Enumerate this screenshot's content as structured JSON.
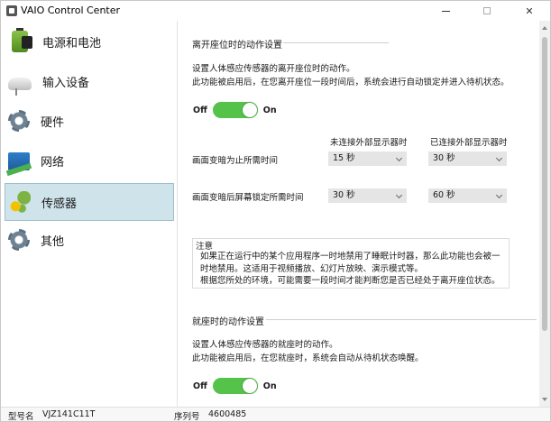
{
  "window": {
    "title": "VAIO Control Center"
  },
  "sidebar": {
    "items": [
      {
        "label": "电源和电池",
        "icon": "battery-icon"
      },
      {
        "label": "输入设备",
        "icon": "mouse-icon"
      },
      {
        "label": "硬件",
        "icon": "gear-icon"
      },
      {
        "label": "网络",
        "icon": "network-icon"
      },
      {
        "label": "传感器",
        "icon": "sensor-icon",
        "selected": true
      },
      {
        "label": "其他",
        "icon": "gear-icon"
      }
    ]
  },
  "away_section": {
    "title": "离开座位时的动作设置",
    "desc_line1": "设置人体感应传感器的离开座位时的动作。",
    "desc_line2": "此功能被启用后，在您离开座位一段时间后，系统会进行自动锁定并进入待机状态。",
    "toggle": {
      "off_label": "Off",
      "on_label": "On",
      "state": "on"
    },
    "col_external_off": "未连接外部显示器时",
    "col_external_on": "已连接外部显示器时",
    "row1": {
      "label": "画面变暗为止所需时间",
      "value_a": "15 秒",
      "value_b": "30 秒"
    },
    "row2": {
      "label": "画面变暗后屏幕锁定所需时间",
      "value_a": "30 秒",
      "value_b": "60 秒"
    },
    "note": {
      "title": "注意",
      "line1": "如果正在运行中的某个应用程序一时地禁用了睡眠计时器，那么此功能也会被一",
      "line2": "时地禁用。这适用于视频播放、幻灯片放映、演示模式等。",
      "line3": "根据您所处的环境，可能需要一段时间才能判断您是否已经处于离开座位状态。"
    }
  },
  "approach_section": {
    "title": "就座时的动作设置",
    "desc_line1": "设置人体感应传感器的就座时的动作。",
    "desc_line2": "此功能被启用后，在您就座时，系统会自动从待机状态唤醒。",
    "toggle": {
      "off_label": "Off",
      "on_label": "On",
      "state": "on"
    }
  },
  "statusbar": {
    "model_label": "型号名",
    "model_value": "VJZ141C11T",
    "serial_label": "序列号",
    "serial_value": "4600485"
  },
  "colors": {
    "toggle_on": "#55c24a",
    "selected_bg": "#cfe3ea"
  }
}
